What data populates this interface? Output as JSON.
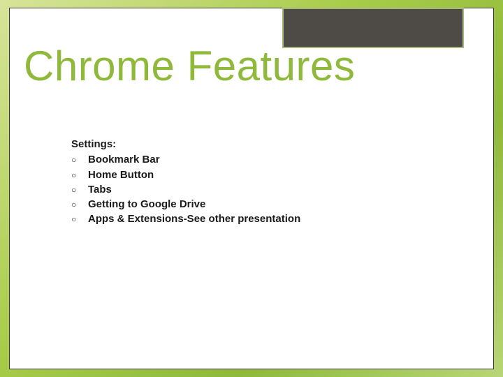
{
  "slide": {
    "title": "Chrome Features",
    "section_label": "Settings:",
    "bullets": [
      "Bookmark Bar",
      "Home Button",
      "Tabs",
      "Getting to Google Drive",
      "Apps & Extensions-See other presentation"
    ]
  }
}
